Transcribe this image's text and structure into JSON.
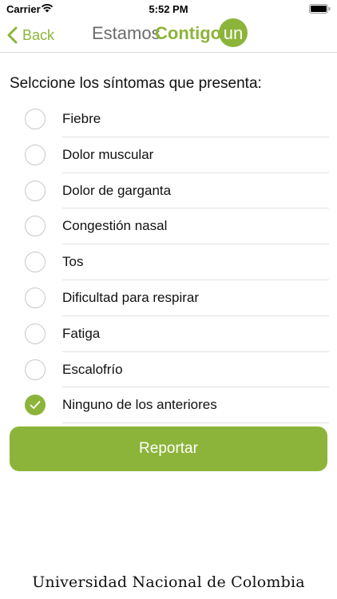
{
  "status_bar": {
    "carrier": "Carrier",
    "time": "5:52 PM",
    "icons": [
      "wifi-icon",
      "battery-icon"
    ]
  },
  "nav": {
    "back_label": "Back",
    "back_icon": "chevron-left-icon",
    "logo_estamos": "Estamos",
    "logo_contigo": "Contigo",
    "logo_badge": "un"
  },
  "colors": {
    "accent": "#8db43a",
    "logo_gray": "#6b6b6b"
  },
  "question": "Selccione los síntomas que presenta:",
  "symptoms": [
    {
      "label": "Fiebre",
      "checked": false
    },
    {
      "label": "Dolor muscular",
      "checked": false
    },
    {
      "label": "Dolor de garganta",
      "checked": false
    },
    {
      "label": "Congestión nasal",
      "checked": false
    },
    {
      "label": "Tos",
      "checked": false
    },
    {
      "label": "Dificultad para respirar",
      "checked": false
    },
    {
      "label": "Fatiga",
      "checked": false
    },
    {
      "label": "Escalofrío",
      "checked": false
    },
    {
      "label": "Ninguno de los anteriores",
      "checked": true
    }
  ],
  "report_button": "Reportar",
  "footer": "Universidad Nacional de Colombia"
}
